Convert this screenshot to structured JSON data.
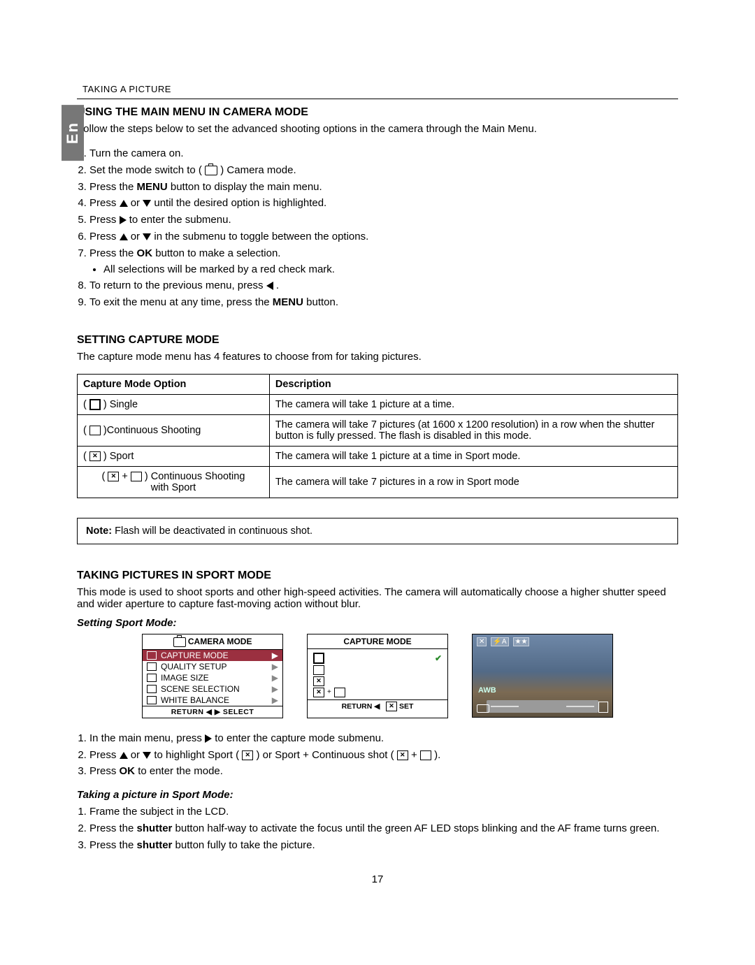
{
  "breadcrumb": "TAKING A PICTURE",
  "side_tab": "En",
  "section1": {
    "title": "USING THE MAIN MENU IN CAMERA MODE",
    "intro": "Follow the steps below to set the advanced shooting options in the camera through the Main Menu.",
    "steps": {
      "s1": "Turn the camera on.",
      "s2a": "Set the mode switch to ( ",
      "s2b": " ) Camera mode.",
      "s3a": "Press the ",
      "s3b": "MENU",
      "s3c": " button to display the main menu.",
      "s4a": "Press ",
      "s4b": " or ",
      "s4c": " until the desired option is highlighted.",
      "s5a": "Press ",
      "s5b": " to enter the submenu.",
      "s6a": "Press ",
      "s6b": " or ",
      "s6c": " in the submenu to toggle between the options.",
      "s7a": "Press the ",
      "s7b": "OK",
      "s7c": " button to make a selection.",
      "s7bullet": "All selections will be marked by a red check mark.",
      "s8a": "To return to the previous menu, press ",
      "s8b": " .",
      "s9a": "To exit the menu at any time, press the ",
      "s9b": "MENU",
      "s9c": " button."
    }
  },
  "section2": {
    "title": "SETTING CAPTURE MODE",
    "intro": "The capture mode menu has 4 features to choose from for taking pictures.",
    "th1": "Capture Mode Option",
    "th2": "Description",
    "r1a": "(       ) Single",
    "r1b": "The camera will take 1 picture at a time.",
    "r2a": "(       )Continuous Shooting",
    "r2b": "The camera will take 7 pictures (at 1600 x 1200 resolution) in a row when the shutter button is fully pressed. The flash is disabled in this mode.",
    "r3a": "(       ) Sport",
    "r3b": "The camera will take 1 picture at a time in Sport mode.",
    "r4a": "(       +       ) Continuous Shooting with Sport",
    "r4b": "The camera will take 7 pictures in a row in Sport mode",
    "note_label": "Note:",
    "note_text": "  Flash will be deactivated in continuous shot."
  },
  "section3": {
    "title": "TAKING PICTURES IN SPORT MODE",
    "intro": "This mode is used to shoot sports and other high-speed activities. The camera will automatically choose a higher shutter speed and wider aperture to capture fast-moving action without blur.",
    "sub1_title": "Setting Sport Mode:",
    "menu1": {
      "header": "CAMERA MODE",
      "items": [
        "CAPTURE MODE",
        "QUALITY SETUP",
        "IMAGE SIZE",
        "SCENE SELECTION",
        "WHITE BALANCE"
      ],
      "footer": "RETURN  ◀  ▶  SELECT"
    },
    "menu2": {
      "header": "CAPTURE MODE",
      "footer": "RETURN ◀     SET"
    },
    "preview_awb": "AWB",
    "steps1": {
      "s1a": "In the main menu, press ",
      "s1b": " to enter the capture mode submenu.",
      "s2a": "Press ",
      "s2b": " or ",
      "s2c": " to highlight Sport ( ",
      "s2d": " ) or Sport + Continuous shot ( ",
      "s2e": " + ",
      "s2f": " ).",
      "s3a": "Press ",
      "s3b": "OK",
      "s3c": " to enter the mode."
    },
    "sub2_title": "Taking a picture in Sport Mode:",
    "steps2": {
      "s1": "Frame the subject in the LCD.",
      "s2a": "Press the ",
      "s2b": "shutter",
      "s2c": " button half-way to activate the focus until the green AF LED stops blinking and the AF frame turns green.",
      "s3a": "Press the ",
      "s3b": "shutter",
      "s3c": " button fully to take the picture."
    }
  },
  "page_number": "17"
}
